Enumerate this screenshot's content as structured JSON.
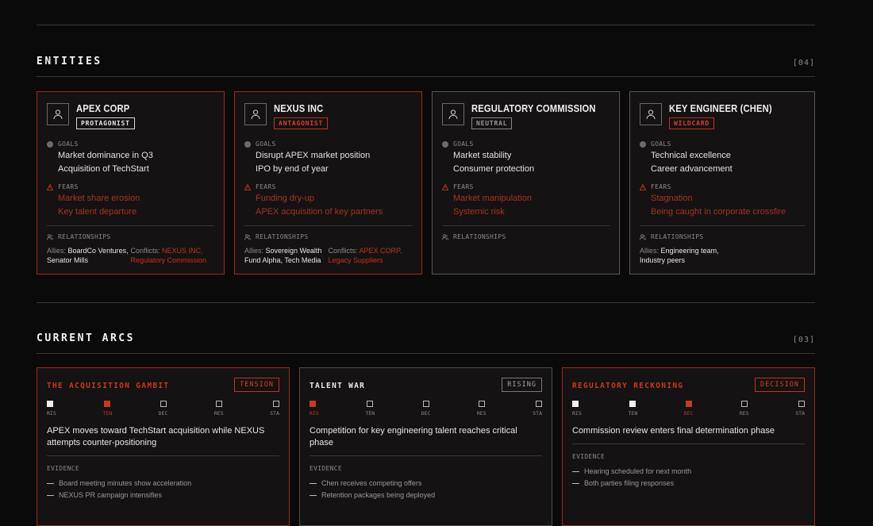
{
  "entities_section": {
    "title": "ENTITIES",
    "count": "[04]"
  },
  "entities": [
    {
      "name": "APEX CORP",
      "role": "PROTAGONIST",
      "goals_label": "GOALS",
      "goals": [
        "Market dominance in Q3",
        "Acquisition of TechStart"
      ],
      "fears_label": "FEARS",
      "fears": [
        "Market share erosion",
        "Key talent departure"
      ],
      "relationships_label": "RELATIONSHIPS",
      "allies_label": "Allies:",
      "allies": "BoardCo Ventures, Senator Mills",
      "conflicts_label": "Conflicts:",
      "conflicts": "NEXUS INC, Regulatory Commission"
    },
    {
      "name": "NEXUS INC",
      "role": "ANTAGONIST",
      "goals_label": "GOALS",
      "goals": [
        "Disrupt APEX market position",
        "IPO by end of year"
      ],
      "fears_label": "FEARS",
      "fears": [
        "Funding dry-up",
        "APEX acquisition of key partners"
      ],
      "relationships_label": "RELATIONSHIPS",
      "allies_label": "Allies:",
      "allies": "Sovereign Wealth Fund Alpha, Tech Media",
      "conflicts_label": "Conflicts:",
      "conflicts": "APEX CORP, Legacy Suppliers"
    },
    {
      "name": "REGULATORY COMMISSION",
      "role": "NEUTRAL",
      "goals_label": "GOALS",
      "goals": [
        "Market stability",
        "Consumer protection"
      ],
      "fears_label": "FEARS",
      "fears": [
        "Market manipulation",
        "Systemic risk"
      ],
      "relationships_label": "RELATIONSHIPS"
    },
    {
      "name": "KEY ENGINEER (CHEN)",
      "role": "WILDCARD",
      "goals_label": "GOALS",
      "goals": [
        "Technical excellence",
        "Career advancement"
      ],
      "fears_label": "FEARS",
      "fears": [
        "Stagnation",
        "Being caught in corporate crossfire"
      ],
      "relationships_label": "RELATIONSHIPS",
      "allies_label": "Allies:",
      "allies": "Engineering team, Industry peers"
    }
  ],
  "arcs_section": {
    "title": "CURRENT ARCS",
    "count": "[03]"
  },
  "stage_labels": [
    "RIS",
    "TEN",
    "DEC",
    "RES",
    "STA"
  ],
  "arcs": [
    {
      "title": "THE ACQUISITION GAMBIT",
      "stage": "TENSION",
      "progress": "2 of 5",
      "description": "APEX moves toward TechStart acquisition while NEXUS attempts counter-positioning",
      "evidence_label": "EVIDENCE",
      "evidence": [
        "Board meeting minutes show acceleration",
        "NEXUS PR campaign intensifies"
      ]
    },
    {
      "title": "TALENT WAR",
      "stage": "RISING",
      "progress": "1 of 5",
      "description": "Competition for key engineering talent reaches critical phase",
      "evidence_label": "EVIDENCE",
      "evidence": [
        "Chen receives competing offers",
        "Retention packages being deployed"
      ]
    },
    {
      "title": "REGULATORY RECKONING",
      "stage": "DECISION",
      "progress": "3 of 5",
      "description": "Commission review enters final determination phase",
      "evidence_label": "EVIDENCE",
      "evidence": [
        "Hearing scheduled for next month",
        "Both parties filing responses"
      ]
    }
  ],
  "colors": {
    "accent": "#c9391f",
    "background": "#0b0a0b",
    "card": "#141213"
  }
}
